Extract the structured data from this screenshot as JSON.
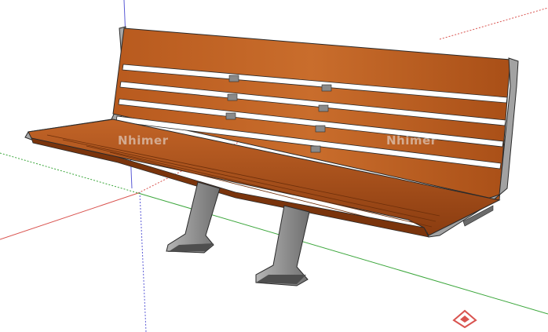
{
  "watermarks": [
    "Nhimer",
    "Nhimer"
  ],
  "colors": {
    "background": "#ffffff",
    "axis_red": "#d9534f",
    "axis_green": "#3aa63a",
    "axis_blue": "#5a5ad6",
    "wood_light": "#c8692a",
    "wood_dark": "#8f3f0e",
    "metal": "#9a9a9a",
    "metal_dark": "#5f5f5f",
    "outline": "#2a2a2a"
  },
  "icons": {
    "corner_logo": "red-house-logo-icon"
  }
}
